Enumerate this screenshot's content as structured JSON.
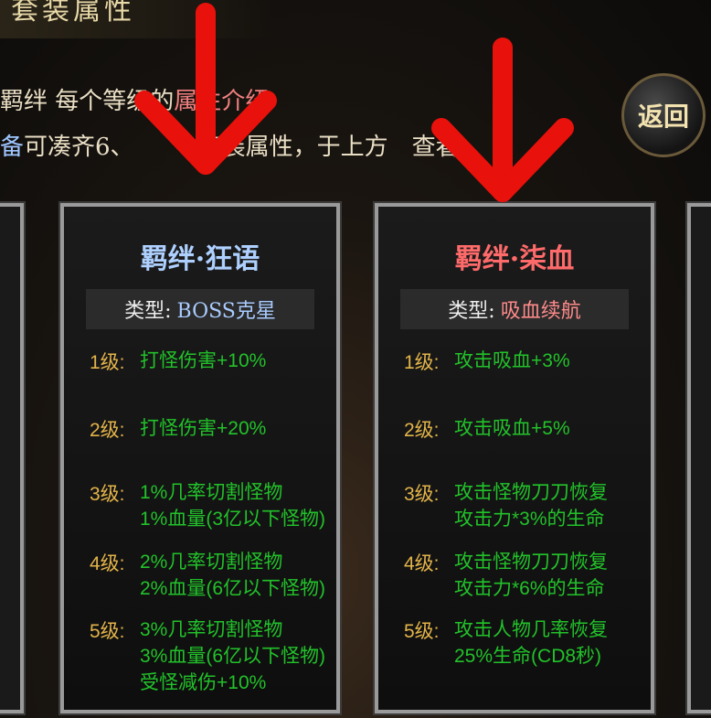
{
  "header": {
    "title": "套装属性"
  },
  "intro": {
    "line1_a": "羁绊 每个等级的",
    "line1_b": "属性介绍",
    "line2_a": "备",
    "line2_b": "可凑齐6、",
    "line2_c": "套装属性，于上方",
    "line2_d": "查看"
  },
  "back_button": {
    "label": "返回"
  },
  "cards": [
    {
      "title": "羁绊·狂语",
      "title_color": "#aed0ff",
      "type_label": "类型:",
      "type_value": "BOSS克星",
      "type_color": "#a9cbff",
      "levels": [
        {
          "label": "1级:",
          "lines": [
            "打怪伤害+10%"
          ]
        },
        {
          "label": "2级:",
          "lines": [
            "打怪伤害+20%"
          ]
        },
        {
          "label": "3级:",
          "lines": [
            "1%几率切割怪物",
            "1%血量(3亿以下怪物)"
          ]
        },
        {
          "label": "4级:",
          "lines": [
            "2%几率切割怪物",
            "2%血量(6亿以下怪物)"
          ]
        },
        {
          "label": "5级:",
          "lines": [
            "3%几率切割怪物",
            "3%血量(6亿以下怪物)",
            "受怪减伤+10%"
          ]
        }
      ]
    },
    {
      "title": "羁绊·柒血",
      "title_color": "#ff6a6a",
      "type_label": "类型:",
      "type_value": "吸血续航",
      "type_color": "#ff8a8a",
      "levels": [
        {
          "label": "1级:",
          "lines": [
            "攻击吸血+3%"
          ]
        },
        {
          "label": "2级:",
          "lines": [
            "攻击吸血+5%"
          ]
        },
        {
          "label": "3级:",
          "lines": [
            "攻击怪物刀刀恢复",
            "攻击力*3%的生命"
          ]
        },
        {
          "label": "4级:",
          "lines": [
            "攻击怪物刀刀恢复",
            "攻击力*6%的生命"
          ]
        },
        {
          "label": "5级:",
          "lines": [
            "攻击人物几率恢复",
            "25%生命(CD8秒)"
          ]
        }
      ]
    }
  ],
  "colors": {
    "arrow": "#e8110b",
    "level_label": "#e3b44a",
    "level_text": "#22c22a"
  }
}
